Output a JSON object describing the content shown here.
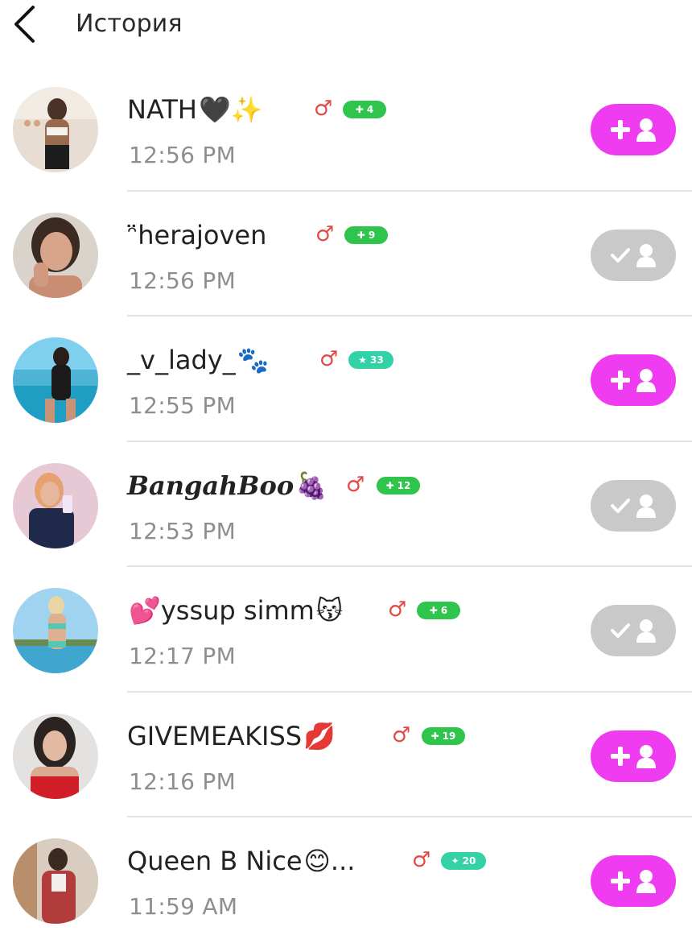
{
  "header": {
    "title": "История",
    "back_icon": "chevron-left-icon"
  },
  "colors": {
    "follow_add": "#f03cf0",
    "follow_added": "#c9c9c9",
    "gender": "#e24a43",
    "level_green": "#2fc44c",
    "level_teal": "#33d2a6"
  },
  "history": [
    {
      "username": "NATH",
      "decor": "🖤✨",
      "time": "12:56 PM",
      "gender_icon": "male-symbol-icon",
      "level_icon": "plus-icon",
      "level": "4",
      "level_color": "green",
      "follow_state": "add"
    },
    {
      "username": "herajoven",
      "prefix": "ᵔ̈ ",
      "time": "12:56 PM",
      "gender_icon": "male-symbol-icon",
      "level_icon": "plus-icon",
      "level": "9",
      "level_color": "green",
      "follow_state": "added"
    },
    {
      "username": "_v_lady_",
      "decor": "🐾",
      "time": "12:55 PM",
      "gender_icon": "male-symbol-icon",
      "level_icon": "star-icon",
      "level": "33",
      "level_color": "teal",
      "follow_state": "add"
    },
    {
      "username": "BangahBoo",
      "decor": "🍇",
      "time": "12:53 PM",
      "gender_icon": "male-symbol-icon",
      "level_icon": "plus-icon",
      "level": "12",
      "level_color": "green",
      "follow_state": "added"
    },
    {
      "username": "yssup simm",
      "prefix": "💕",
      "decor": "😽",
      "time": "12:17 PM",
      "gender_icon": "male-symbol-icon",
      "level_icon": "plus-icon",
      "level": "6",
      "level_color": "green",
      "follow_state": "added"
    },
    {
      "username": "GIVEMEAKISS ",
      "decor": "💋",
      "time": "12:16 PM",
      "gender_icon": "male-symbol-icon",
      "level_icon": "plus-icon",
      "level": "19",
      "level_color": "green",
      "follow_state": "add"
    },
    {
      "username": "Queen B Nice",
      "decor": "😊...",
      "time": "11:59 AM",
      "gender_icon": "male-symbol-icon",
      "level_icon": "diamond-icon",
      "level": "20",
      "level_color": "teal",
      "follow_state": "add"
    }
  ]
}
